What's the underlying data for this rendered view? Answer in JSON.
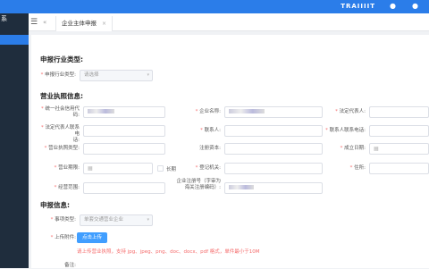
{
  "header": {
    "brand": "TRAIIIIT",
    "sidebar_logo": "系"
  },
  "tabbar": {
    "back": "«",
    "active_tab": "企业主体申报",
    "close": "×"
  },
  "sections": {
    "industry": "申报行业类型:",
    "license": "营业执照信息:",
    "apply": "申报信息:"
  },
  "form": {
    "industry_label": "申报行业类型:",
    "industry_placeholder": "请选择",
    "credit_code_label_1": "统一社会信用代",
    "credit_code_label_2": "码:",
    "company_name_label": "企业名称:",
    "legal_rep_label": "法定代表人:",
    "legal_rep_tel_label_1": "法定代表人联系电",
    "legal_rep_tel_label_2": "话:",
    "contact_label": "联系人:",
    "contact_tel_label": "联系人联系电话:",
    "license_type_label": "营业执照类型:",
    "reg_capital_label": "注册资本:",
    "established_label": "成立日期:",
    "business_term_label": "营业期限:",
    "long_term_label": "长期",
    "reg_authority_label": "登记机关:",
    "address_label": "住所:",
    "scope_label": "经营范围:",
    "reg_no_label_1": "企业注册号（字审为",
    "reg_no_label_2": "海关注册编码）:",
    "matter_type_label": "事项类型:",
    "matter_type_value": "单套交通营业企业",
    "attachment_label": "上传附件:",
    "upload_button": "点击上传",
    "upload_hint": "请上传营业执照，支持 jpg、jpeg、png、doc、docx、pdf 格式，单件最小于10M",
    "remark_label": "备注:"
  },
  "colors": {
    "primary": "#2b7de9",
    "sidebar": "#1f2d3d",
    "required": "#f56c6c",
    "button": "#409eff"
  },
  "icons": [
    "menu-icon",
    "calendar-icon",
    "chevron-down-icon",
    "bell-icon",
    "user-icon"
  ]
}
